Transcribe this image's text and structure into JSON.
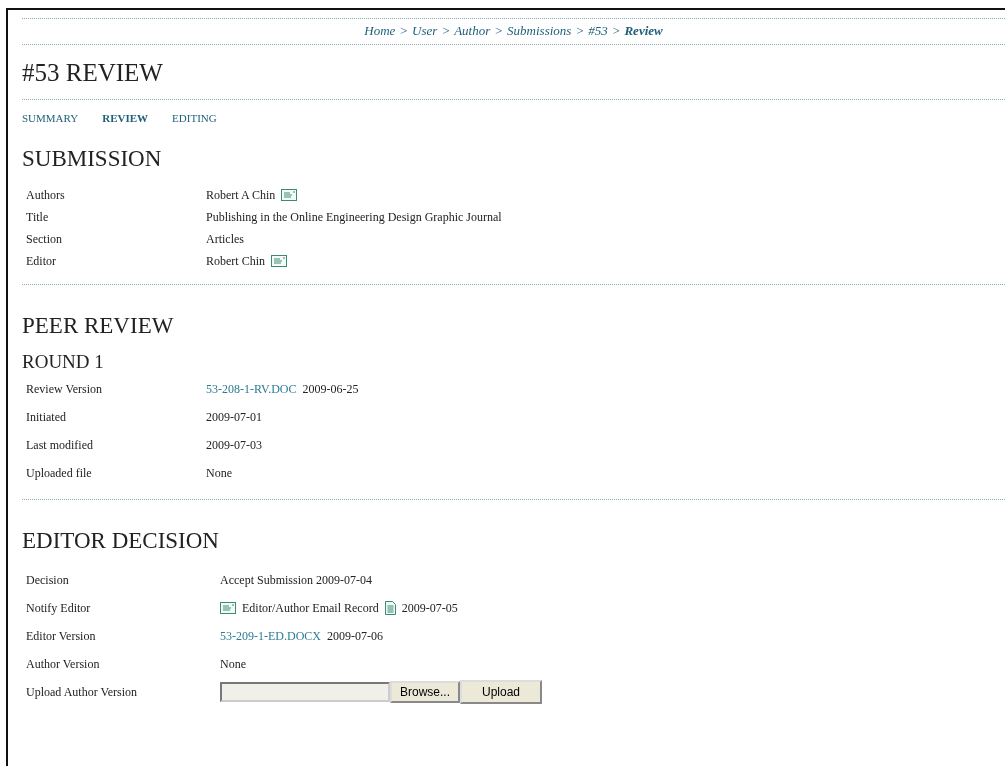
{
  "breadcrumb": {
    "separator": ">",
    "items": [
      {
        "label": "Home",
        "selected": false
      },
      {
        "label": "User",
        "selected": false
      },
      {
        "label": "Author",
        "selected": false
      },
      {
        "label": "Submissions",
        "selected": false
      },
      {
        "label": "#53",
        "selected": false
      },
      {
        "label": "Review",
        "selected": true
      }
    ]
  },
  "page_title": "#53 REVIEW",
  "tabs": [
    {
      "label": "SUMMARY",
      "selected": false
    },
    {
      "label": "REVIEW",
      "selected": true
    },
    {
      "label": "EDITING",
      "selected": false
    }
  ],
  "sections": [
    {
      "heading": "SUBMISSION",
      "rows": [
        {
          "label": "Authors",
          "parts": [
            {
              "kind": "text",
              "text": "Robert A Chin"
            },
            {
              "kind": "mail"
            }
          ]
        },
        {
          "label": "Title",
          "parts": [
            {
              "kind": "text",
              "text": "Publishing in the Online Engineering Design Graphic Journal"
            }
          ]
        },
        {
          "label": "Section",
          "parts": [
            {
              "kind": "text",
              "text": "Articles"
            }
          ]
        },
        {
          "label": "Editor",
          "parts": [
            {
              "kind": "text",
              "text": "Robert Chin"
            },
            {
              "kind": "mail"
            }
          ]
        }
      ]
    },
    {
      "heading": "PEER REVIEW",
      "subheading": "ROUND 1",
      "rows": [
        {
          "label": "Review Version",
          "parts": [
            {
              "kind": "link",
              "text": "53-208-1-RV.DOC"
            },
            {
              "kind": "text",
              "text": "2009-06-25"
            }
          ]
        },
        {
          "label": "Initiated",
          "parts": [
            {
              "kind": "text",
              "text": "2009-07-01"
            }
          ]
        },
        {
          "label": "Last modified",
          "parts": [
            {
              "kind": "text",
              "text": "2009-07-03"
            }
          ]
        },
        {
          "label": "Uploaded file",
          "parts": [
            {
              "kind": "text",
              "text": "None"
            }
          ]
        }
      ]
    },
    {
      "heading": "EDITOR DECISION",
      "rows": [
        {
          "label": "Decision",
          "parts": [
            {
              "kind": "text",
              "text": "Accept Submission 2009-07-04"
            }
          ]
        },
        {
          "label": "Notify Editor",
          "parts": [
            {
              "kind": "mail"
            },
            {
              "kind": "text",
              "text": "Editor/Author Email Record"
            },
            {
              "kind": "doc"
            },
            {
              "kind": "text",
              "text": "2009-07-05"
            }
          ]
        },
        {
          "label": "Editor Version",
          "parts": [
            {
              "kind": "link",
              "text": "53-209-1-ED.DOCX"
            },
            {
              "kind": "text",
              "text": "2009-07-06"
            }
          ]
        },
        {
          "label": "Author Version",
          "parts": [
            {
              "kind": "text",
              "text": "None"
            }
          ]
        },
        {
          "label": "Upload Author Version",
          "parts": [
            {
              "kind": "file"
            },
            {
              "kind": "browse",
              "text": "Browse..."
            },
            {
              "kind": "button",
              "text": "Upload"
            }
          ]
        }
      ]
    }
  ]
}
